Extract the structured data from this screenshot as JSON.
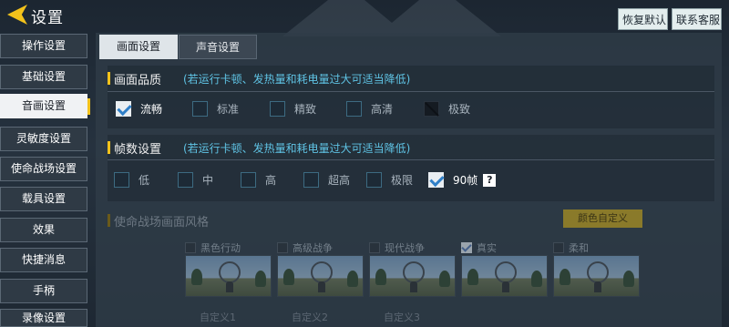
{
  "header": {
    "title": "设置",
    "restore_label": "恢复默认",
    "service_label": "联系客服"
  },
  "sidebar": {
    "items": [
      {
        "label": "操作设置",
        "active": false
      },
      {
        "label": "基础设置",
        "active": false
      },
      {
        "label": "音画设置",
        "active": true
      },
      {
        "label": "灵敏度设置",
        "active": false
      },
      {
        "label": "使命战场设置",
        "active": false
      },
      {
        "label": "载具设置",
        "active": false
      },
      {
        "label": "效果",
        "active": false
      },
      {
        "label": "快捷消息",
        "active": false
      },
      {
        "label": "手柄",
        "active": false
      },
      {
        "label": "录像设置",
        "active": false
      }
    ]
  },
  "tabs": [
    {
      "label": "画面设置",
      "active": true
    },
    {
      "label": "声音设置",
      "active": false
    }
  ],
  "quality": {
    "title": "画面品质",
    "hint": "(若运行卡顿、发热量和耗电量过大可适当降低)",
    "options": [
      {
        "label": "流畅",
        "checked": true,
        "disabled": false
      },
      {
        "label": "标准",
        "checked": false,
        "disabled": false
      },
      {
        "label": "精致",
        "checked": false,
        "disabled": false
      },
      {
        "label": "高清",
        "checked": false,
        "disabled": false
      },
      {
        "label": "极致",
        "checked": false,
        "disabled": true
      }
    ]
  },
  "framerate": {
    "title": "帧数设置",
    "hint": "(若运行卡顿、发热量和耗电量过大可适当降低)",
    "options": [
      {
        "label": "低",
        "checked": false
      },
      {
        "label": "中",
        "checked": false
      },
      {
        "label": "高",
        "checked": false
      },
      {
        "label": "超高",
        "checked": false
      },
      {
        "label": "极限",
        "checked": false
      },
      {
        "label": "90帧",
        "checked": true
      }
    ],
    "help": "?"
  },
  "style": {
    "title": "使命战场画面风格",
    "custom_button": "颜色自定义",
    "options": [
      {
        "label": "黑色行动",
        "checked": false
      },
      {
        "label": "高级战争",
        "checked": false
      },
      {
        "label": "现代战争",
        "checked": false
      },
      {
        "label": "真实",
        "checked": true
      },
      {
        "label": "柔和",
        "checked": false
      }
    ],
    "custom_labels": [
      "自定义1",
      "自定义2",
      "自定义3"
    ]
  },
  "colors": {
    "accent": "#f3c21b",
    "hint": "#5fc3e4",
    "check": "#2f7fc8"
  }
}
